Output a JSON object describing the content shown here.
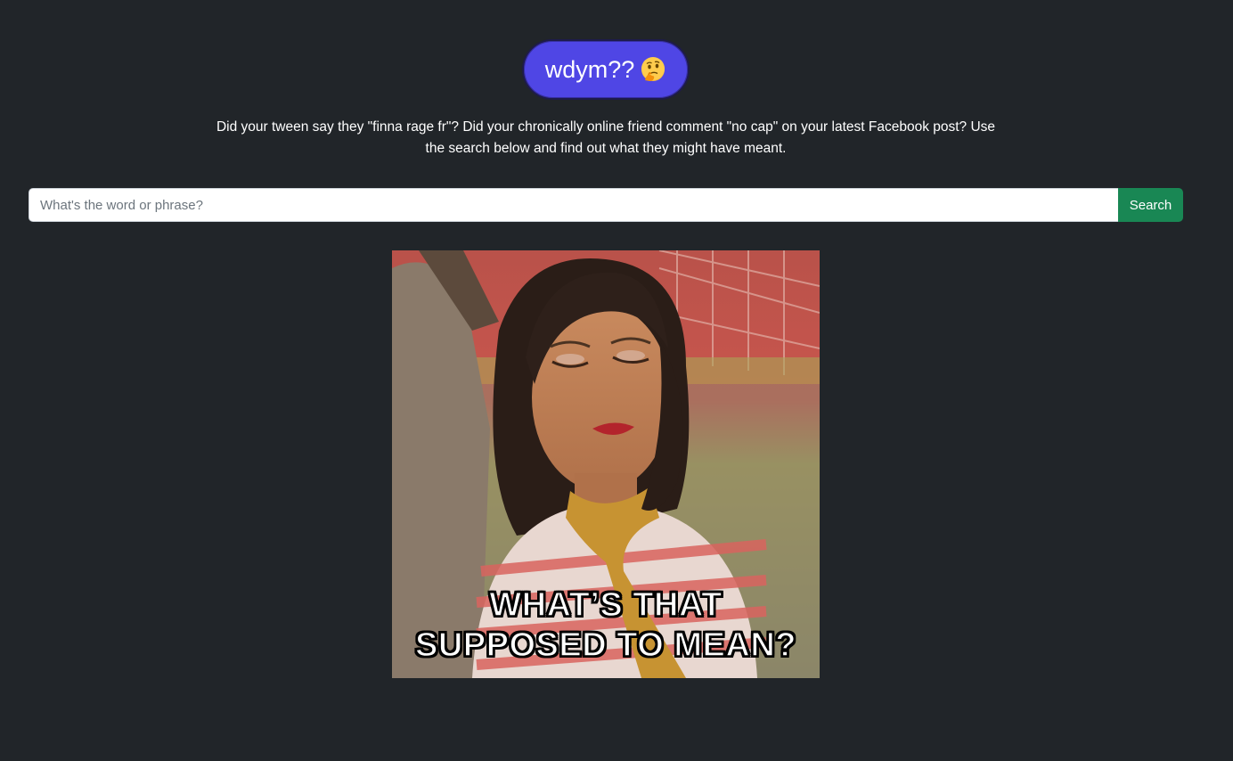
{
  "brand": {
    "label": "wdym??",
    "emoji_icon": "thinking-face-icon"
  },
  "intro": {
    "text": "Did your tween say they \"finna rage fr\"? Did your chronically online friend comment \"no cap\" on your latest Facebook post? Use the search below and find out what they might have meant."
  },
  "search": {
    "placeholder": "What's the word or phrase?",
    "value": "",
    "button_label": "Search"
  },
  "meme": {
    "caption_line1": "WHAT’S THAT",
    "caption_line2": "SUPPOSED TO MEAN?"
  },
  "colors": {
    "background": "#212529",
    "brand": "#4f46e5",
    "button": "#198754"
  }
}
